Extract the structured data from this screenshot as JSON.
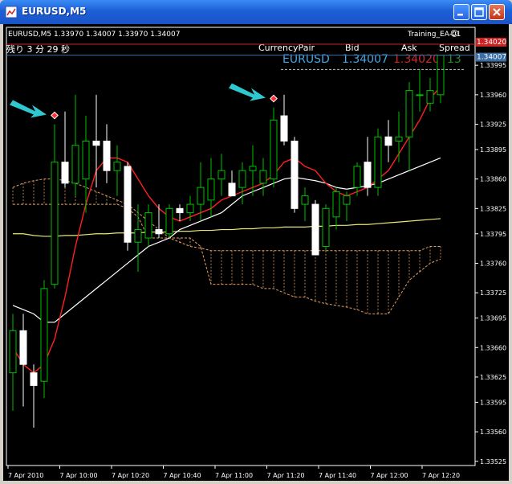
{
  "window": {
    "title": "EURUSD,M5"
  },
  "header": {
    "symbol_info": "EURUSD,M5 1.33970 1.34007 1.33970 1.34007",
    "ea_name": "Training_EA-01",
    "ea_status": "☺",
    "countdown": "残り 3 分 29 秒"
  },
  "table": {
    "headers": [
      "CurrencyPair",
      "Bid",
      "Ask",
      "Spread"
    ],
    "row": {
      "pair": "EURUSD",
      "bid": "1.34007",
      "ask": "1.34020",
      "spread": "13"
    }
  },
  "price_markers": {
    "ask": "1.34020",
    "bid": "1.34007"
  },
  "colors": {
    "bull_candle": "#00c000",
    "bear_candle": "#ffffff",
    "fast_ma": "#ff2020",
    "slow_ma": "#ffffff",
    "long_ma": "#e8e87a",
    "ichimoku_cloud": "#e8a060",
    "ask_line": "#cc2222",
    "bid_line": "#3a6ea5",
    "arrow": "#30c8d0",
    "text_table": "#4aa3e0"
  },
  "chart_data": {
    "type": "candlestick",
    "ylim": [
      1.3352,
      1.3404
    ],
    "y_ticks": [
      "1.33995",
      "1.33960",
      "1.33925",
      "1.33895",
      "1.33860",
      "1.33825",
      "1.33795",
      "1.33760",
      "1.33725",
      "1.33695",
      "1.33660",
      "1.33625",
      "1.33595",
      "1.33560",
      "1.33525"
    ],
    "x_ticks": [
      "7 Apr 2010",
      "7 Apr 10:00",
      "7 Apr 10:20",
      "7 Apr 10:40",
      "7 Apr 11:00",
      "7 Apr 11:20",
      "7 Apr 11:40",
      "7 Apr 12:00",
      "7 Apr 12:20"
    ],
    "candles": [
      {
        "o": 1.3363,
        "h": 1.337,
        "l": 1.33585,
        "c": 1.3368
      },
      {
        "o": 1.3368,
        "h": 1.337,
        "l": 1.3359,
        "c": 1.3364
      },
      {
        "o": 1.3363,
        "h": 1.3364,
        "l": 1.33565,
        "c": 1.33615
      },
      {
        "o": 1.3362,
        "h": 1.3374,
        "l": 1.336,
        "c": 1.3373
      },
      {
        "o": 1.33735,
        "h": 1.33925,
        "l": 1.3373,
        "c": 1.3388
      },
      {
        "o": 1.3388,
        "h": 1.3394,
        "l": 1.3385,
        "c": 1.33855
      },
      {
        "o": 1.33855,
        "h": 1.3396,
        "l": 1.3384,
        "c": 1.339
      },
      {
        "o": 1.3386,
        "h": 1.33935,
        "l": 1.3382,
        "c": 1.33905
      },
      {
        "o": 1.33905,
        "h": 1.3396,
        "l": 1.3385,
        "c": 1.339
      },
      {
        "o": 1.33905,
        "h": 1.33925,
        "l": 1.33855,
        "c": 1.3387
      },
      {
        "o": 1.3387,
        "h": 1.339,
        "l": 1.3384,
        "c": 1.3388
      },
      {
        "o": 1.33875,
        "h": 1.3388,
        "l": 1.33775,
        "c": 1.33785
      },
      {
        "o": 1.33785,
        "h": 1.3383,
        "l": 1.3375,
        "c": 1.338
      },
      {
        "o": 1.3379,
        "h": 1.3383,
        "l": 1.3378,
        "c": 1.3382
      },
      {
        "o": 1.338,
        "h": 1.3383,
        "l": 1.3379,
        "c": 1.33795
      },
      {
        "o": 1.33795,
        "h": 1.3383,
        "l": 1.3379,
        "c": 1.33825
      },
      {
        "o": 1.33825,
        "h": 1.3383,
        "l": 1.3381,
        "c": 1.3382
      },
      {
        "o": 1.3382,
        "h": 1.3384,
        "l": 1.3381,
        "c": 1.3383
      },
      {
        "o": 1.3383,
        "h": 1.3388,
        "l": 1.3381,
        "c": 1.3385
      },
      {
        "o": 1.33835,
        "h": 1.33885,
        "l": 1.33815,
        "c": 1.3386
      },
      {
        "o": 1.3386,
        "h": 1.3389,
        "l": 1.3384,
        "c": 1.3387
      },
      {
        "o": 1.33855,
        "h": 1.3387,
        "l": 1.3384,
        "c": 1.3384
      },
      {
        "o": 1.3385,
        "h": 1.3388,
        "l": 1.3383,
        "c": 1.3387
      },
      {
        "o": 1.3387,
        "h": 1.339,
        "l": 1.3384,
        "c": 1.33875
      },
      {
        "o": 1.33855,
        "h": 1.33885,
        "l": 1.3384,
        "c": 1.3387
      },
      {
        "o": 1.3386,
        "h": 1.33945,
        "l": 1.3385,
        "c": 1.3393
      },
      {
        "o": 1.33935,
        "h": 1.3396,
        "l": 1.339,
        "c": 1.33905
      },
      {
        "o": 1.33905,
        "h": 1.3391,
        "l": 1.3382,
        "c": 1.33825
      },
      {
        "o": 1.3383,
        "h": 1.3385,
        "l": 1.3381,
        "c": 1.3384
      },
      {
        "o": 1.3383,
        "h": 1.33835,
        "l": 1.3377,
        "c": 1.3377
      },
      {
        "o": 1.3378,
        "h": 1.3383,
        "l": 1.33775,
        "c": 1.33825
      },
      {
        "o": 1.33815,
        "h": 1.3385,
        "l": 1.338,
        "c": 1.33845
      },
      {
        "o": 1.3383,
        "h": 1.33845,
        "l": 1.3381,
        "c": 1.3384
      },
      {
        "o": 1.3385,
        "h": 1.3388,
        "l": 1.3384,
        "c": 1.33875
      },
      {
        "o": 1.3388,
        "h": 1.3391,
        "l": 1.3384,
        "c": 1.3385
      },
      {
        "o": 1.3385,
        "h": 1.3392,
        "l": 1.3384,
        "c": 1.3391
      },
      {
        "o": 1.3391,
        "h": 1.3393,
        "l": 1.3388,
        "c": 1.339
      },
      {
        "o": 1.33905,
        "h": 1.3394,
        "l": 1.3388,
        "c": 1.3391
      },
      {
        "o": 1.3391,
        "h": 1.33975,
        "l": 1.3387,
        "c": 1.33965
      },
      {
        "o": 1.3396,
        "h": 1.3399,
        "l": 1.3394,
        "c": 1.3396
      },
      {
        "o": 1.3395,
        "h": 1.3398,
        "l": 1.3394,
        "c": 1.33965
      },
      {
        "o": 1.3396,
        "h": 1.34,
        "l": 1.3395,
        "c": 1.34007
      }
    ],
    "fast_ma": [
      1.3366,
      1.3364,
      1.3363,
      1.3364,
      1.3367,
      1.3372,
      1.3378,
      1.3383,
      1.3387,
      1.33885,
      1.33885,
      1.3388,
      1.3386,
      1.3384,
      1.33825,
      1.33815,
      1.3381,
      1.33815,
      1.3382,
      1.33825,
      1.33835,
      1.3384,
      1.33845,
      1.3385,
      1.33855,
      1.33865,
      1.3388,
      1.33885,
      1.33875,
      1.3387,
      1.33855,
      1.33845,
      1.3384,
      1.33845,
      1.3385,
      1.3386,
      1.3387,
      1.3389,
      1.3391,
      1.3393,
      1.33955,
      1.3397
    ],
    "slow_ma": [
      1.3371,
      1.33705,
      1.337,
      1.3369,
      1.3369,
      1.337,
      1.3371,
      1.3372,
      1.3373,
      1.3374,
      1.3375,
      1.3376,
      1.3377,
      1.3378,
      1.33785,
      1.3379,
      1.338,
      1.33805,
      1.3381,
      1.33815,
      1.3382,
      1.3383,
      1.3384,
      1.33845,
      1.3385,
      1.33855,
      1.3386,
      1.33862,
      1.3386,
      1.33858,
      1.33855,
      1.3385,
      1.33848,
      1.3385,
      1.33852,
      1.33855,
      1.3386,
      1.33865,
      1.3387,
      1.33875,
      1.3388,
      1.33885
    ],
    "long_ma": [
      1.33795,
      1.33795,
      1.33793,
      1.33792,
      1.33792,
      1.33793,
      1.33793,
      1.33794,
      1.33795,
      1.33795,
      1.33796,
      1.33796,
      1.33796,
      1.33797,
      1.33797,
      1.33797,
      1.33798,
      1.33798,
      1.33799,
      1.33799,
      1.338,
      1.338,
      1.33801,
      1.33801,
      1.33802,
      1.33802,
      1.33803,
      1.33803,
      1.33803,
      1.33804,
      1.33804,
      1.33805,
      1.33805,
      1.33806,
      1.33806,
      1.33807,
      1.33808,
      1.33809,
      1.3381,
      1.33811,
      1.33812,
      1.33813
    ],
    "cloud_top": [
      1.3385,
      1.33855,
      1.33858,
      1.3386,
      1.3386,
      1.33858,
      1.33855,
      1.3385,
      1.33845,
      1.3384,
      1.33835,
      1.3383,
      1.3382,
      1.3381,
      1.338,
      1.3379,
      1.33785,
      1.3378,
      1.33778,
      1.33775,
      1.33775,
      1.33775,
      1.33775,
      1.33775,
      1.33775,
      1.33775,
      1.33775,
      1.33775,
      1.33775,
      1.33775,
      1.33775,
      1.33775,
      1.33775,
      1.33775,
      1.33775,
      1.33775,
      1.33775,
      1.33775,
      1.33775,
      1.33775,
      1.3378,
      1.3378
    ],
    "cloud_bottom": [
      1.3383,
      1.3383,
      1.3383,
      1.3383,
      1.3383,
      1.3383,
      1.3383,
      1.3383,
      1.3383,
      1.3383,
      1.3383,
      1.33825,
      1.33815,
      1.3379,
      1.3379,
      1.3379,
      1.3379,
      1.3379,
      1.3378,
      1.33735,
      1.33735,
      1.33735,
      1.33735,
      1.33735,
      1.3373,
      1.3373,
      1.33725,
      1.3372,
      1.3372,
      1.33715,
      1.33712,
      1.3371,
      1.33708,
      1.33705,
      1.337,
      1.337,
      1.337,
      1.3372,
      1.3374,
      1.3375,
      1.3376,
      1.33765
    ],
    "arrows": [
      {
        "index": 4
      },
      {
        "index": 25
      }
    ]
  }
}
